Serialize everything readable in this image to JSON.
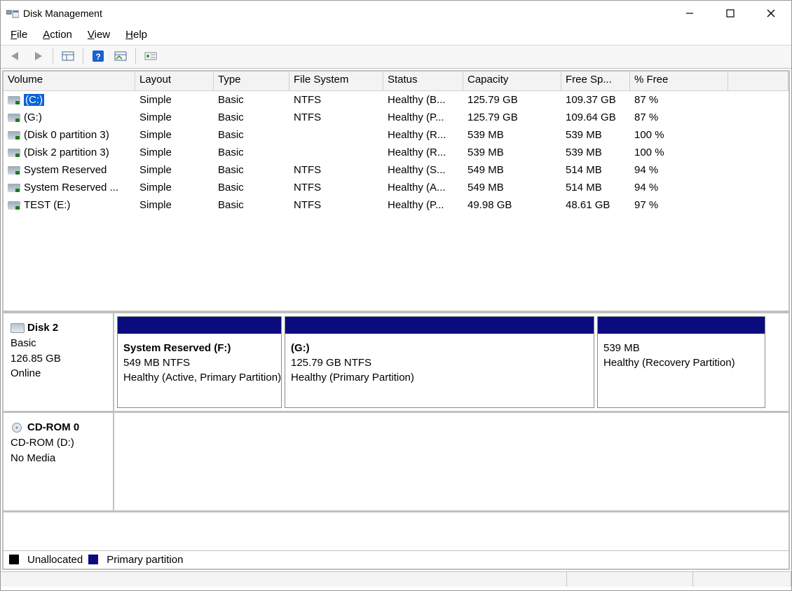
{
  "titlebar": {
    "title": "Disk Management"
  },
  "menubar": {
    "file": "File",
    "action": "Action",
    "view": "View",
    "help": "Help"
  },
  "toolbar": {
    "back": "back-arrow",
    "forward": "forward-arrow",
    "properties": "properties",
    "help": "help",
    "details": "details",
    "settings": "settings"
  },
  "volume_table": {
    "columns": [
      "Volume",
      "Layout",
      "Type",
      "File System",
      "Status",
      "Capacity",
      "Free Sp...",
      "% Free"
    ],
    "rows": [
      {
        "volume": "(C:)",
        "layout": "Simple",
        "type": "Basic",
        "fs": "NTFS",
        "status": "Healthy (B...",
        "capacity": "125.79 GB",
        "free": "109.37 GB",
        "pct": "87 %",
        "selected": true
      },
      {
        "volume": " (G:)",
        "layout": "Simple",
        "type": "Basic",
        "fs": "NTFS",
        "status": "Healthy (P...",
        "capacity": "125.79 GB",
        "free": "109.64 GB",
        "pct": "87 %",
        "selected": false
      },
      {
        "volume": "(Disk 0 partition 3)",
        "layout": "Simple",
        "type": "Basic",
        "fs": "",
        "status": "Healthy (R...",
        "capacity": "539 MB",
        "free": "539 MB",
        "pct": "100 %",
        "selected": false
      },
      {
        "volume": "(Disk 2 partition 3)",
        "layout": "Simple",
        "type": "Basic",
        "fs": "",
        "status": "Healthy (R...",
        "capacity": "539 MB",
        "free": "539 MB",
        "pct": "100 %",
        "selected": false
      },
      {
        "volume": "System Reserved",
        "layout": "Simple",
        "type": "Basic",
        "fs": "NTFS",
        "status": "Healthy (S...",
        "capacity": "549 MB",
        "free": "514 MB",
        "pct": "94 %",
        "selected": false
      },
      {
        "volume": "System Reserved ...",
        "layout": "Simple",
        "type": "Basic",
        "fs": "NTFS",
        "status": "Healthy (A...",
        "capacity": "549 MB",
        "free": "514 MB",
        "pct": "94 %",
        "selected": false
      },
      {
        "volume": "TEST (E:)",
        "layout": "Simple",
        "type": "Basic",
        "fs": "NTFS",
        "status": "Healthy (P...",
        "capacity": "49.98 GB",
        "free": "48.61 GB",
        "pct": "97 %",
        "selected": false
      }
    ]
  },
  "disks": [
    {
      "icon": "disk",
      "title": "Disk 2",
      "lines": [
        "Basic",
        "126.85 GB",
        "Online"
      ],
      "partitions": [
        {
          "widthpx": 235,
          "name": "System Reserved  (F:)",
          "size": "549 MB NTFS",
          "status": "Healthy (Active, Primary Partition)"
        },
        {
          "widthpx": 442,
          "name": "(G:)",
          "size": "125.79 GB NTFS",
          "status": "Healthy (Primary Partition)"
        },
        {
          "widthpx": 240,
          "name": "",
          "size": "539 MB",
          "status": "Healthy (Recovery Partition)"
        }
      ]
    },
    {
      "icon": "cdrom",
      "title": "CD-ROM 0",
      "lines": [
        "CD-ROM (D:)",
        "",
        "No Media"
      ],
      "partitions": []
    }
  ],
  "legend": {
    "unallocated": "Unallocated",
    "primary": "Primary partition"
  }
}
